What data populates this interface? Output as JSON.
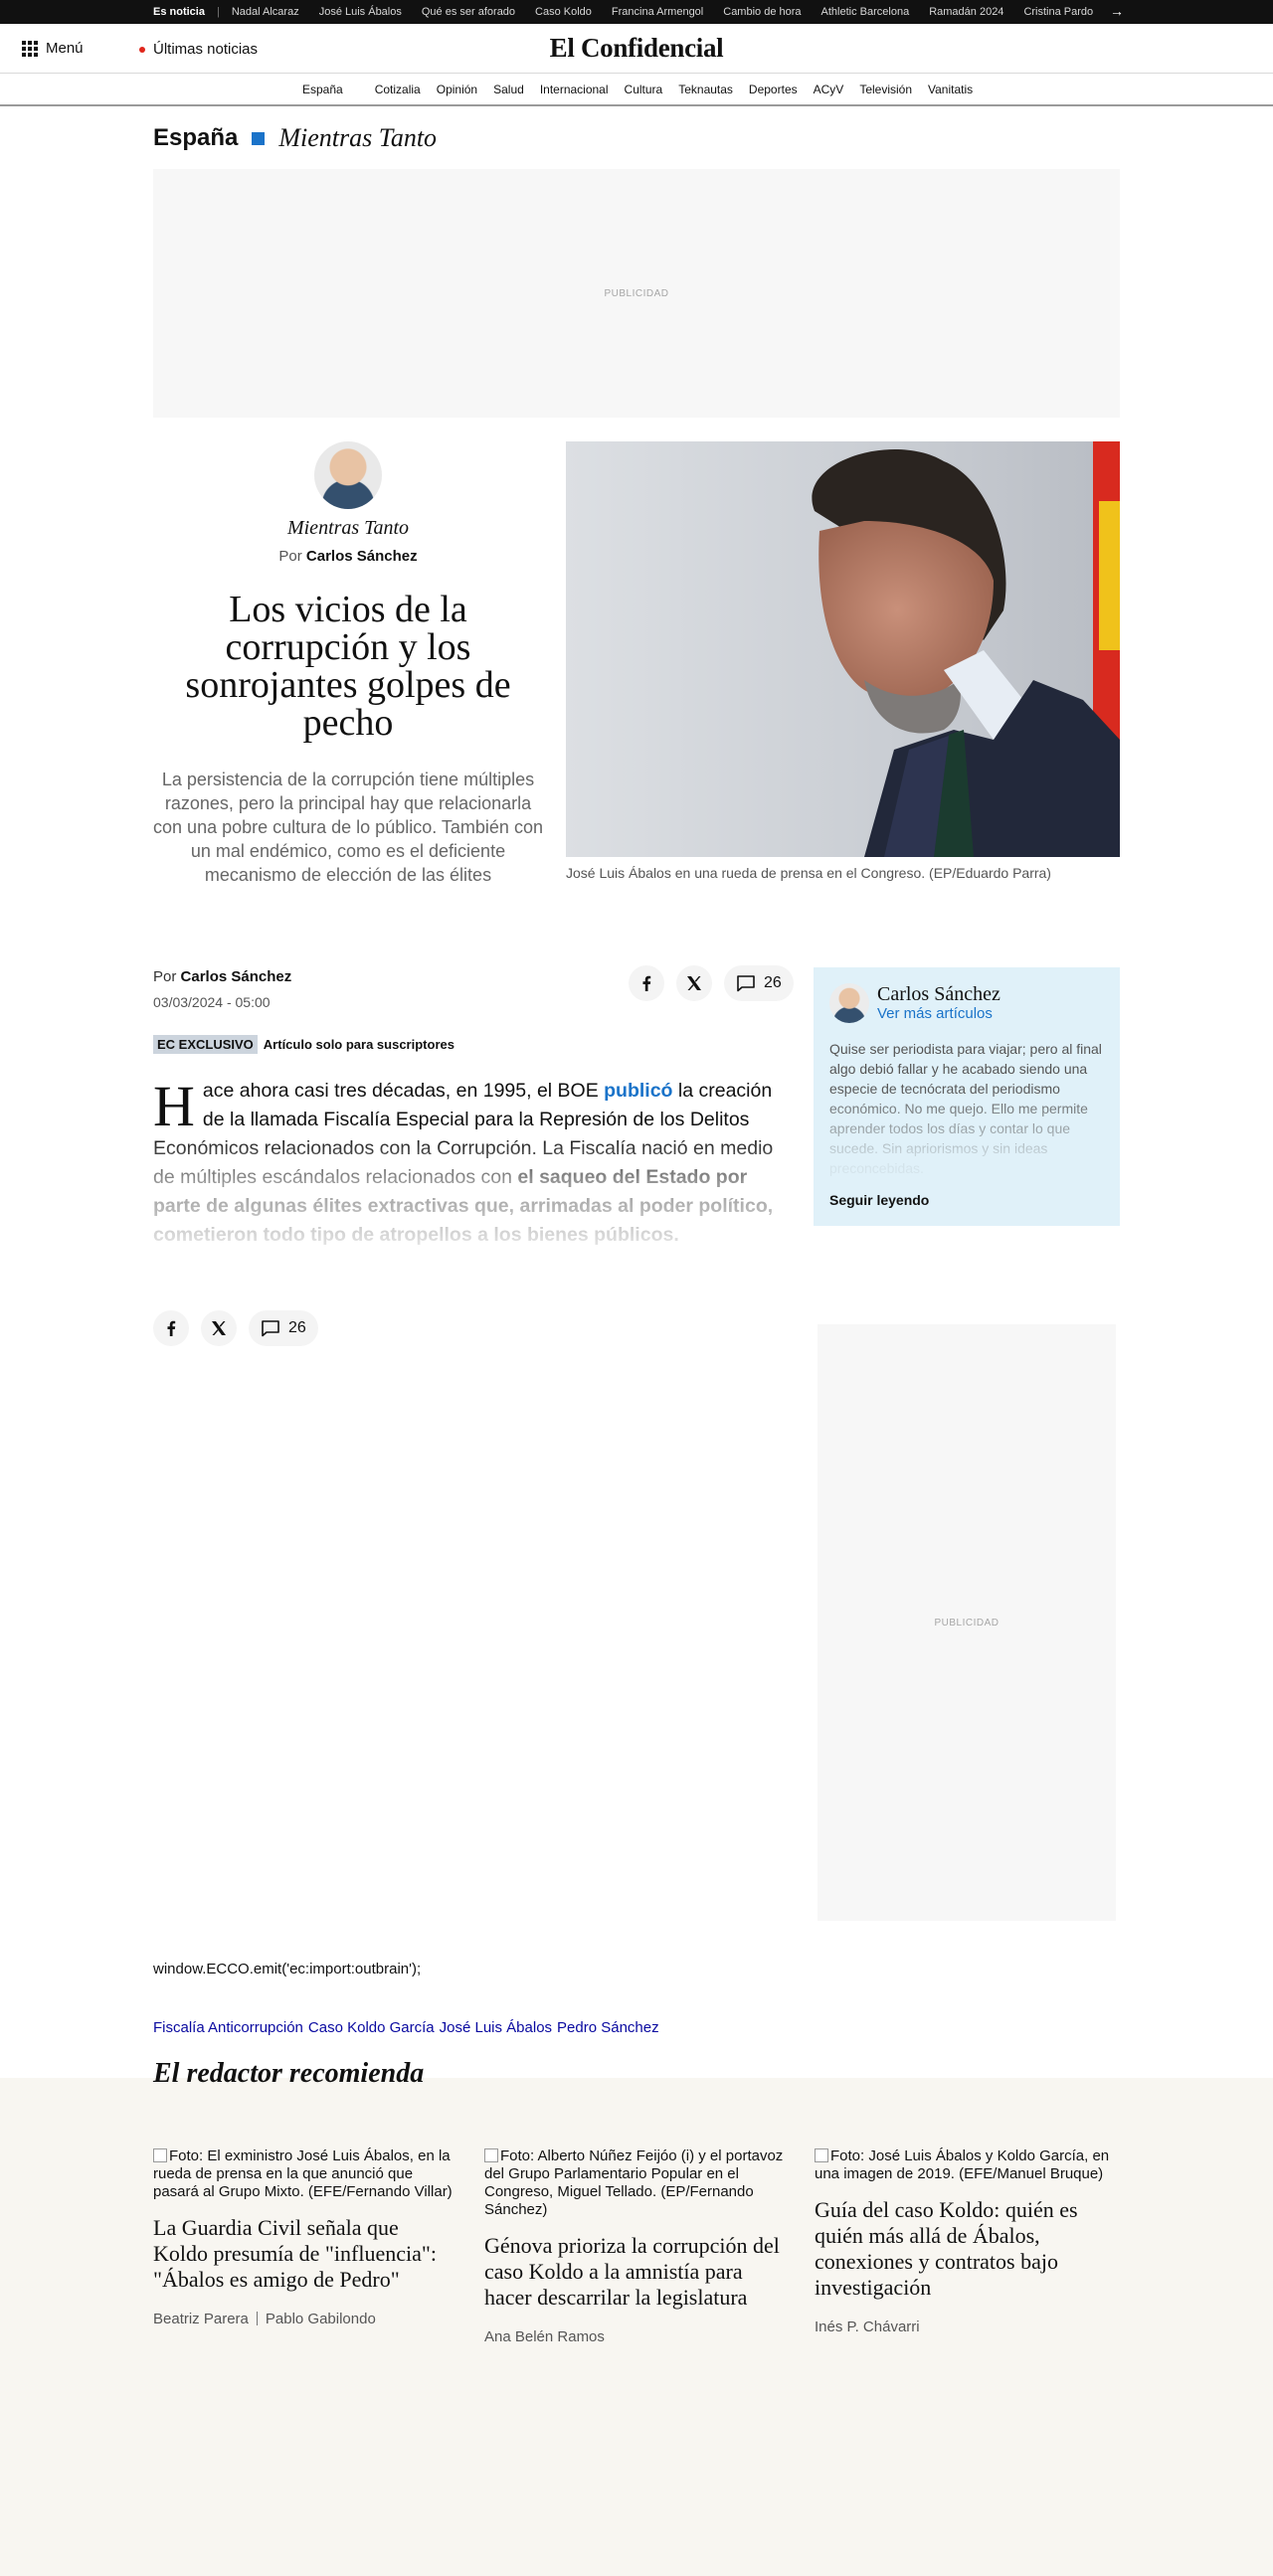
{
  "topbar": {
    "items": [
      "Es noticia",
      "Nadal Alcaraz",
      "José Luis Ábalos",
      "Qué es ser aforado",
      "Caso Koldo",
      "Francina Armengol",
      "Cambio de hora",
      "Athletic Barcelona",
      "Ramadán 2024",
      "Cristina Pardo"
    ],
    "separator": "|",
    "arrow": "→"
  },
  "header": {
    "menu_label": "Menú",
    "latest_label": "Últimas noticias",
    "logo": "El Confidencial"
  },
  "sections": [
    "España",
    "Cotizalia",
    "Opinión",
    "Salud",
    "Internacional",
    "Cultura",
    "Teknautas",
    "Deportes",
    "ACyV",
    "Televisión",
    "Vanitatis"
  ],
  "breadcrumb": {
    "section": "España",
    "blog": "Mientras Tanto"
  },
  "ad_label": "PUBLICIDAD",
  "hero": {
    "blog": "Mientras Tanto",
    "by_prefix": "Por",
    "author": "Carlos Sánchez",
    "title": "Los vicios de la corrupción y los sonrojantes golpes de pecho",
    "subtitle": "La persistencia de la corrupción tiene múltiples razones, pero la principal hay que relacionarla con una pobre cultura de lo público. También con un mal endémico, como es el deficiente mecanismo de elección de las élites",
    "caption": "José Luis Ábalos en una rueda de prensa en el Congreso. (EP/Eduardo Parra)"
  },
  "article": {
    "by_prefix": "Por",
    "author": "Carlos Sánchez",
    "date": "03/03/2024 - 05:00",
    "comments_count": "26",
    "exclusive_tag": "EC EXCLUSIVO",
    "exclusive_text": "Artículo solo para suscriptores",
    "dropcap": "H",
    "p1": "ace ahora casi tres décadas, en 1995, el BOE ",
    "p1_link": "publicó",
    "p2": " la creación de la llamada Fiscalía Especial para la Represión de los Delitos Económicos relacionados con la Corrupción. La Fiscalía nació en medio de múltiples escándalos relacionados con ",
    "p2_bold": "el saqueo del Estado por parte de algunas élites extractivas que, arrimadas al poder político, cometieron todo tipo de atropellos a los bienes públicos."
  },
  "author_box": {
    "name": "Carlos Sánchez",
    "more": "Ver más artículos",
    "bio": "Quise ser periodista para viajar; pero al final algo debió fallar y he acabado siendo una especie de tecnócrata del periodismo económico. No me quejo. Ello me permite aprender todos los días y contar lo que sucede. Sin apriorismos y sin ideas preconcebidas.",
    "continue": "Seguir leyendo"
  },
  "script_text": "window.ECCO.emit('ec:import:outbrain');",
  "tags": [
    "Fiscalía Anticorrupción",
    "Caso Koldo García",
    "José Luis Ábalos",
    "Pedro Sánchez"
  ],
  "recommended": {
    "title": "El redactor recomienda",
    "cards": [
      {
        "alt": "Foto: El exministro José Luis Ábalos, en la rueda de prensa en la que anunció que pasará al Grupo Mixto. (EFE/Fernando Villar)",
        "title": "La Guardia Civil señala que Koldo presumía de \"influencia\": \"Ábalos es amigo de Pedro\"",
        "authors": [
          "Beatriz Parera",
          "Pablo Gabilondo"
        ]
      },
      {
        "alt": "Foto: Alberto Núñez Feijóo (i) y el portavoz del Grupo Parlamentario Popular en el Congreso, Miguel Tellado. (EP/Fernando Sánchez)",
        "title": "Génova prioriza la corrupción del caso Koldo a la amnistía para hacer descarrilar la legislatura",
        "authors": [
          "Ana Belén Ramos"
        ]
      },
      {
        "alt": "Foto: José Luis Ábalos y Koldo García, en una imagen de 2019. (EFE/Manuel Bruque)",
        "title": "Guía del caso Koldo: quién es quién más allá de Ábalos, conexiones y contratos bajo investigación",
        "authors": [
          "Inés P. Chávarri"
        ]
      }
    ]
  },
  "colors": {
    "accent_blue": "#1a73c9",
    "author_box_bg": "#e0f1f9",
    "recommend_bg": "#f8f6f1",
    "tag_link": "#0a0aa0"
  },
  "icons": [
    "grid-menu-icon",
    "red-dot-icon",
    "arrow-right-icon",
    "facebook-icon",
    "x-icon",
    "comment-icon"
  ]
}
